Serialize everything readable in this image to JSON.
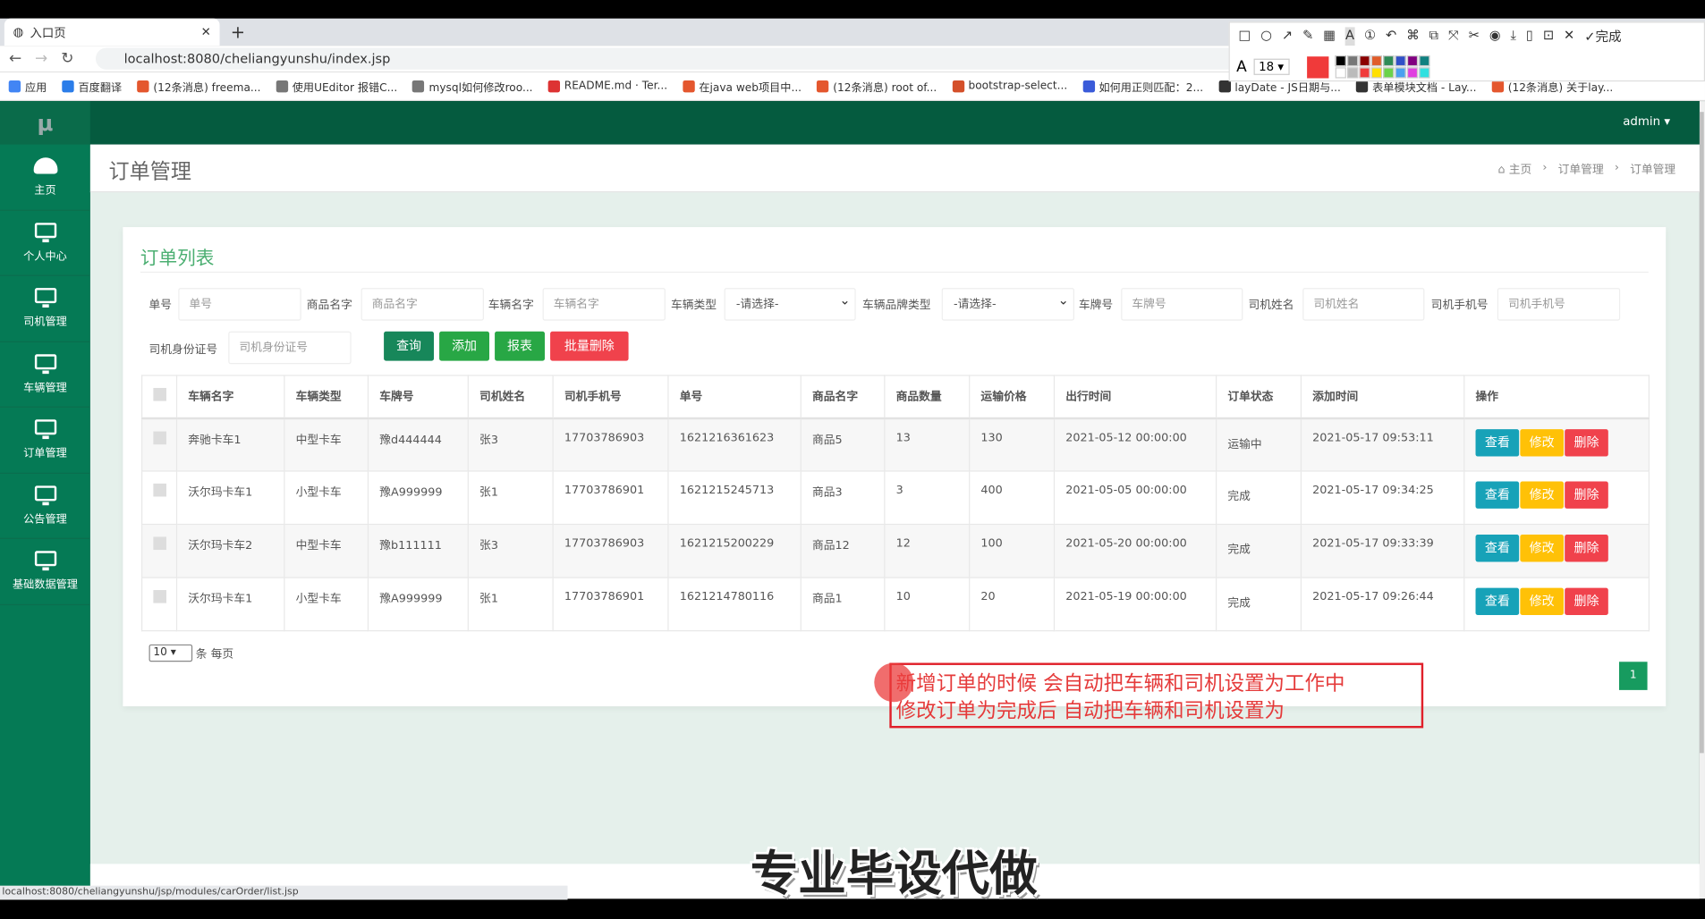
{
  "browser": {
    "tab_title": "入口页",
    "url": "localhost:8080/cheliangyunshu/index.jsp",
    "bookmarks": [
      "应用",
      "百度翻译",
      "(12条消息) freema...",
      "使用UEditor 报错C...",
      "mysql如何修改roo...",
      "README.md · Ter...",
      "在java web项目中...",
      "(12条消息) root of...",
      "bootstrap-select...",
      "如何用正则匹配：2...",
      "layDate - JS日期与...",
      "表单模块文档 - Lay...",
      "(12条消息) 关于lay..."
    ],
    "status_url": "localhost:8080/cheliangyunshu/jsp/modules/carOrder/list.jsp"
  },
  "snip_toolbar": {
    "done_label": "完成",
    "font_size": "18",
    "active_color": "#f03a3a"
  },
  "sidebar": {
    "logo": "μ",
    "items": [
      {
        "label": "主页",
        "icon": "dashboard-icon"
      },
      {
        "label": "个人中心",
        "icon": "monitor-icon"
      },
      {
        "label": "司机管理",
        "icon": "monitor-icon"
      },
      {
        "label": "车辆管理",
        "icon": "monitor-icon"
      },
      {
        "label": "订单管理",
        "icon": "monitor-icon"
      },
      {
        "label": "公告管理",
        "icon": "monitor-icon"
      },
      {
        "label": "基础数据管理",
        "icon": "monitor-icon"
      }
    ]
  },
  "header": {
    "user": "admin"
  },
  "page": {
    "title": "订单管理",
    "breadcrumb": [
      "主页",
      "订单管理",
      "订单管理"
    ]
  },
  "card": {
    "title": "订单列表"
  },
  "filters": {
    "order_no": {
      "label": "单号",
      "placeholder": "单号"
    },
    "goods_name": {
      "label": "商品名字",
      "placeholder": "商品名字"
    },
    "car_name": {
      "label": "车辆名字",
      "placeholder": "车辆名字"
    },
    "car_type": {
      "label": "车辆类型",
      "value": "-请选择-"
    },
    "car_brand": {
      "label": "车辆品牌类型",
      "value": "-请选择-"
    },
    "plate": {
      "label": "车牌号",
      "placeholder": "车牌号"
    },
    "driver_name": {
      "label": "司机姓名",
      "placeholder": "司机姓名"
    },
    "driver_phone": {
      "label": "司机手机号",
      "placeholder": "司机手机号"
    },
    "driver_id": {
      "label": "司机身份证号",
      "placeholder": "司机身份证号"
    }
  },
  "buttons": {
    "search": "查询",
    "add": "添加",
    "report": "报表",
    "batch_delete": "批量删除"
  },
  "table": {
    "headers": [
      "车辆名字",
      "车辆类型",
      "车牌号",
      "司机姓名",
      "司机手机号",
      "单号",
      "商品名字",
      "商品数量",
      "运输价格",
      "出行时间",
      "订单状态",
      "添加时间",
      "操作"
    ],
    "rows": [
      [
        "奔驰卡车1",
        "中型卡车",
        "豫d444444",
        "张3",
        "17703786903",
        "1621216361623",
        "商品5",
        "13",
        "130",
        "2021-05-12 00:00:00",
        "运输中",
        "2021-05-17 09:53:11"
      ],
      [
        "沃尔玛卡车1",
        "小型卡车",
        "豫A999999",
        "张1",
        "17703786901",
        "1621215245713",
        "商品3",
        "3",
        "400",
        "2021-05-05 00:00:00",
        "完成",
        "2021-05-17 09:34:25"
      ],
      [
        "沃尔玛卡车2",
        "中型卡车",
        "豫b111111",
        "张3",
        "17703786903",
        "1621215200229",
        "商品12",
        "12",
        "100",
        "2021-05-20 00:00:00",
        "完成",
        "2021-05-17 09:33:39"
      ],
      [
        "沃尔玛卡车1",
        "小型卡车",
        "豫A999999",
        "张1",
        "17703786901",
        "1621214780116",
        "商品1",
        "10",
        "20",
        "2021-05-19 00:00:00",
        "完成",
        "2021-05-17 09:26:44"
      ]
    ],
    "actions": {
      "view": "查看",
      "edit": "修改",
      "delete": "删除"
    }
  },
  "pagination": {
    "page_size": "10",
    "page_size_suffix": "条 每页",
    "current_page": "1"
  },
  "annotation": {
    "line1": "新增订单的时候 会自动把车辆和司机设置为工作中",
    "line2": "修改订单为完成后 自动把车辆和司机设置为"
  },
  "watermark": "专业毕设代做",
  "colors": {
    "sidebar": "#057a55",
    "topbar": "#055b3f",
    "search": "#17875a",
    "add": "#28a745",
    "report": "#28a745",
    "batch_delete": "#f0424c",
    "view": "#17a2b8",
    "edit": "#ffc107",
    "delete": "#f0424c",
    "annotation": "#e0202a"
  }
}
